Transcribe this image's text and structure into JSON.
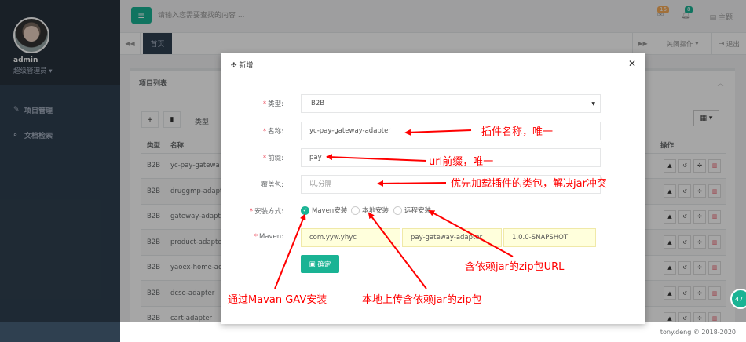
{
  "sidebar": {
    "username": "admin",
    "role": "超级管理员",
    "items": [
      {
        "icon": "edit-icon",
        "label": "项目管理"
      },
      {
        "icon": "search-icon",
        "label": "文档检索"
      }
    ]
  },
  "topbar": {
    "search_placeholder": "请输入您需要查找的内容 ...",
    "mail_count": "16",
    "bell_count": "8",
    "theme_label": "主题"
  },
  "tabs": {
    "home": "首页",
    "close_ops": "关闭操作",
    "logout": "退出"
  },
  "panel": {
    "title": "项目列表",
    "filter_label": "类型",
    "columns": [
      "类型",
      "名称",
      "操作"
    ],
    "rows": [
      {
        "type": "B2B",
        "name": "yc-pay-gatewa"
      },
      {
        "type": "B2B",
        "name": "druggmp-adapt"
      },
      {
        "type": "B2B",
        "name": "gateway-adapte"
      },
      {
        "type": "B2B",
        "name": "product-adapte"
      },
      {
        "type": "B2B",
        "name": "yaoex-home-ac"
      },
      {
        "type": "B2B",
        "name": "dcso-adapter"
      },
      {
        "type": "B2B",
        "name": "cart-adapter"
      }
    ]
  },
  "footer": {
    "text": "tony.deng © 2018-2020",
    "float_badge": "47"
  },
  "modal": {
    "title": "新增",
    "type_label": "类型:",
    "type_value": "B2B",
    "name_label": "名称:",
    "name_value": "yc-pay-gateway-adapter",
    "prefix_label": "前缀:",
    "prefix_value": "pay",
    "override_label": "覆盖包:",
    "override_placeholder": "以,分隔",
    "install_label": "安装方式:",
    "install_options": [
      "Maven安装",
      "本地安装",
      "远程安装"
    ],
    "install_selected": "Maven安装",
    "maven_label": "Maven:",
    "maven_group": "com.yyw.yhyc",
    "maven_artifact": "pay-gateway-adapter",
    "maven_version": "1.0.0-SNAPSHOT",
    "confirm_label": "确定"
  },
  "annotations": {
    "plugin_name": "插件名称，唯一",
    "url_prefix": "url前缀，唯一",
    "override": "优先加载插件的类包，解决jar冲突",
    "zip_url": "含依赖jar的zip包URL",
    "maven_install": "通过Mavan GAV安装",
    "local_upload": "本地上传含依赖jar的zip包"
  },
  "colors": {
    "sidebar_bg": "#2f4050",
    "accent": "#1ab394",
    "annotation": "#ff0000",
    "danger": "#ed5565"
  }
}
